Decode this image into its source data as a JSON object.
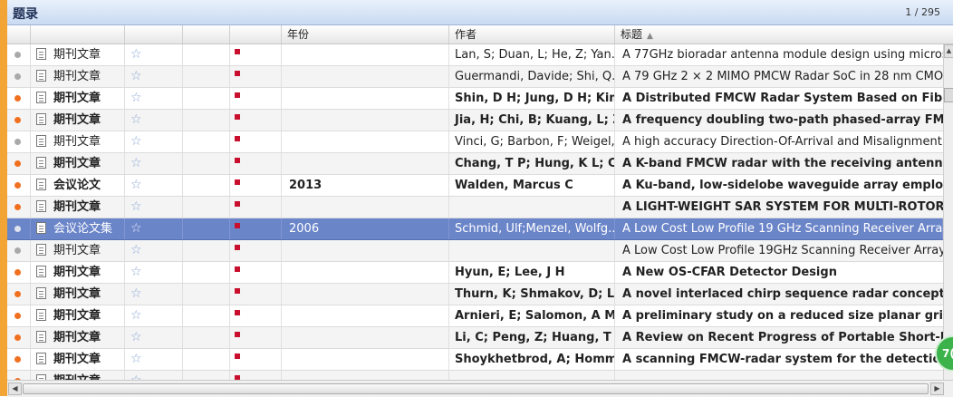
{
  "panel": {
    "title": "题录",
    "page_count": "1 / 295"
  },
  "columns": {
    "year": "年份",
    "author": "作者",
    "title": "标题"
  },
  "rows": [
    {
      "status": "read",
      "type": "期刊文章",
      "year": "",
      "author": "Lan, S; Duan, L; He, Z; Yan...",
      "title": "A 77GHz bioradar antenna module design using microstrip",
      "bold": false
    },
    {
      "status": "read",
      "type": "期刊文章",
      "year": "",
      "author": "Guermandi, Davide; Shi, Q...",
      "title": "A 79 GHz 2 × 2 MIMO PMCW Radar SoC in 28 nm CMOS",
      "bold": false
    },
    {
      "status": "unread",
      "type": "期刊文章",
      "year": "",
      "author": "Shin, D H; Jung, D H; Kim,",
      "title": "A Distributed FMCW Radar System Based on Fiber-Optic",
      "bold": true
    },
    {
      "status": "unread",
      "type": "期刊文章",
      "year": "",
      "author": "Jia, H; Chi, B; Kuang, L; Zh",
      "title": "A frequency doubling two-path phased-array FMCW",
      "bold": true
    },
    {
      "status": "read",
      "type": "期刊文章",
      "year": "",
      "author": "Vinci, G; Barbon, F; Weigel,...",
      "title": "A high accuracy Direction-Of-Arrival and Misalignment A",
      "bold": false
    },
    {
      "status": "unread",
      "type": "期刊文章",
      "year": "",
      "author": "Chang, T P; Hung, K L; Ch.",
      "title": "A K-band FMCW radar with the receiving antenna div",
      "bold": true
    },
    {
      "status": "unread",
      "type": "会议论文",
      "year": "2013",
      "author": "Walden, Marcus C",
      "title": "A Ku-band, low-sidelobe waveguide array employing",
      "bold": true
    },
    {
      "status": "unread",
      "type": "期刊文章",
      "year": "",
      "author": "",
      "title": "A LIGHT-WEIGHT SAR SYSTEM FOR MULTI-ROTOR UA",
      "bold": true
    },
    {
      "status": "read",
      "type": "会议论文集",
      "year": "2006",
      "author": "Schmid, Ulf;Menzel, Wolfg...",
      "title": "A Low Cost Low Profile 19 GHz Scanning Receiver Array w",
      "bold": false
    },
    {
      "status": "read",
      "type": "期刊文章",
      "year": "",
      "author": "",
      "title": "A Low Cost Low Profile 19GHz Scanning Receiver Array w",
      "bold": false
    },
    {
      "status": "unread",
      "type": "期刊文章",
      "year": "",
      "author": "Hyun, E; Lee, J H",
      "title": "A New OS-CFAR Detector Design",
      "bold": true
    },
    {
      "status": "unread",
      "type": "期刊文章",
      "year": "",
      "author": "Thurn, K; Shmakov, D; Li, .",
      "title": "A novel interlaced chirp sequence radar concept with",
      "bold": true
    },
    {
      "status": "unread",
      "type": "期刊文章",
      "year": "",
      "author": "Arnieri, E; Salomon, A M;",
      "title": "A preliminary study on a reduced size planar grid arr",
      "bold": true
    },
    {
      "status": "unread",
      "type": "期刊文章",
      "year": "",
      "author": "Li, C; Peng, Z; Huang, T Y;",
      "title": "A Review on Recent Progress of Portable Short-Rang",
      "bold": true
    },
    {
      "status": "unread",
      "type": "期刊文章",
      "year": "",
      "author": "Shoykhetbrod, A; Homme",
      "title": "A scanning FMCW-radar system for the detection of",
      "bold": true
    },
    {
      "status": "unread",
      "type": "期刊文章",
      "year": "",
      "author": "",
      "title": "",
      "bold": true
    }
  ],
  "selected_index": 8,
  "fab_label": "7("
}
